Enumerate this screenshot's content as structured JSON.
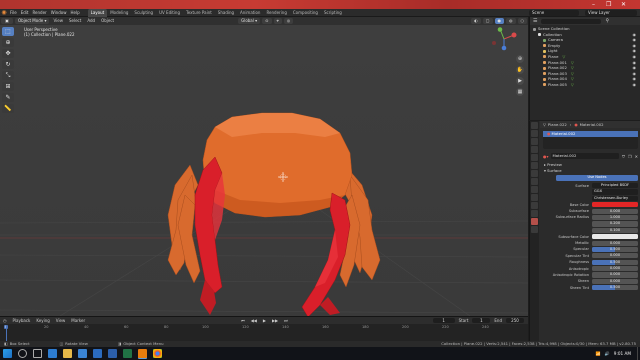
{
  "top_bar": {
    "minimize": "–",
    "maximize": "❐",
    "close": "✕"
  },
  "menus": [
    "File",
    "Edit",
    "Render",
    "Window",
    "Help"
  ],
  "workspace_tabs": [
    {
      "label": "Layout",
      "active": true
    },
    {
      "label": "Modeling",
      "active": false
    },
    {
      "label": "Sculpting",
      "active": false
    },
    {
      "label": "UV Editing",
      "active": false
    },
    {
      "label": "Texture Paint",
      "active": false
    },
    {
      "label": "Shading",
      "active": false
    },
    {
      "label": "Animation",
      "active": false
    },
    {
      "label": "Rendering",
      "active": false
    },
    {
      "label": "Compositing",
      "active": false
    },
    {
      "label": "Scripting",
      "active": false
    }
  ],
  "scene": {
    "name": "Scene",
    "view_layer": "View Layer"
  },
  "viewport_header": {
    "mode": "Object Mode",
    "menus": [
      "View",
      "Select",
      "Add",
      "Object"
    ],
    "orientation": "Global"
  },
  "viewport_info": {
    "line1": "User Perspective",
    "line2": "(1) Collection | Plane.022"
  },
  "outliner": {
    "items": [
      {
        "label": "Scene Collection",
        "indent": 0,
        "color": "#9a9a9a"
      },
      {
        "label": "Collection",
        "indent": 1,
        "color": "#e0e0e0"
      },
      {
        "label": "Camera",
        "indent": 2,
        "color": "#7da86a"
      },
      {
        "label": "Empty",
        "indent": 2,
        "color": "#e0a060"
      },
      {
        "label": "Light",
        "indent": 2,
        "color": "#e0c060"
      },
      {
        "label": "Plane",
        "indent": 2,
        "color": "#e0a060"
      },
      {
        "label": "Plane.001",
        "indent": 2,
        "color": "#e0a060"
      },
      {
        "label": "Plane.002",
        "indent": 2,
        "color": "#e0a060"
      },
      {
        "label": "Plane.003",
        "indent": 2,
        "color": "#e0a060"
      },
      {
        "label": "Plane.004",
        "indent": 2,
        "color": "#e0a060"
      },
      {
        "label": "Plane.005",
        "indent": 2,
        "color": "#e0a060"
      }
    ]
  },
  "properties": {
    "breadcrumb_object": "Plane.022",
    "breadcrumb_material": "Material.002",
    "slot": "Material.002",
    "material_name": "Material.002",
    "preview_label": "Preview",
    "surface_label": "Surface",
    "use_nodes": "Use Nodes",
    "surface_shader_label": "Surface",
    "surface_shader": "Principled BSDF",
    "distribution": "GGX",
    "subsurface_method": "Christensen-Burley",
    "fields": [
      {
        "label": "Base Color",
        "value": "",
        "kind": "color",
        "color": "#e32626"
      },
      {
        "label": "Subsurface",
        "value": "0.000",
        "kind": "number"
      },
      {
        "label": "Subsurface Radius",
        "value": "1.000",
        "kind": "number"
      },
      {
        "label": "",
        "value": "0.200",
        "kind": "number"
      },
      {
        "label": "",
        "value": "0.100",
        "kind": "number"
      },
      {
        "label": "Subsurface Color",
        "value": "",
        "kind": "color",
        "color": "#e8e8e8"
      },
      {
        "label": "Metallic",
        "value": "0.000",
        "kind": "number"
      },
      {
        "label": "Specular",
        "value": "0.500",
        "kind": "slider",
        "fill": 0.5
      },
      {
        "label": "Specular Tint",
        "value": "0.000",
        "kind": "number"
      },
      {
        "label": "Roughness",
        "value": "0.500",
        "kind": "slider",
        "fill": 0.5
      },
      {
        "label": "Anisotropic",
        "value": "0.000",
        "kind": "number"
      },
      {
        "label": "Anisotropic Rotation",
        "value": "0.000",
        "kind": "number"
      },
      {
        "label": "Sheen",
        "value": "0.000",
        "kind": "number"
      },
      {
        "label": "Sheen Tint",
        "value": "0.500",
        "kind": "slider",
        "fill": 0.5
      }
    ]
  },
  "timeline": {
    "menus": [
      "Playback",
      "Keying",
      "View",
      "Marker"
    ],
    "current_frame": "1",
    "start_label": "Start",
    "start": "1",
    "end_label": "End",
    "end": "250",
    "ticks": [
      "0",
      "20",
      "40",
      "60",
      "80",
      "100",
      "120",
      "140",
      "160",
      "180",
      "200",
      "220",
      "240"
    ]
  },
  "status_bar": {
    "select": "Box Select",
    "rotate": "Rotate View",
    "menu": "Object Context Menu",
    "stats": "Collection | Plane.022 | Verts:2,541 | Faces:2,538 | Tris:4,998 | Objects:0/30 | Mem: 63.7 MB | v2.80.75"
  },
  "taskbar": {
    "time": "9:01 AM",
    "date": "",
    "icons": [
      "start",
      "cortana",
      "task-view",
      "edge",
      "explorer",
      "store",
      "mail",
      "word",
      "excel",
      "blender",
      "chrome"
    ]
  },
  "colors": {
    "crab_body": "#e26a2c",
    "crab_claw": "#d91f2a",
    "accent_blue": "#4a72b8",
    "top_strip": "#c0362f"
  }
}
